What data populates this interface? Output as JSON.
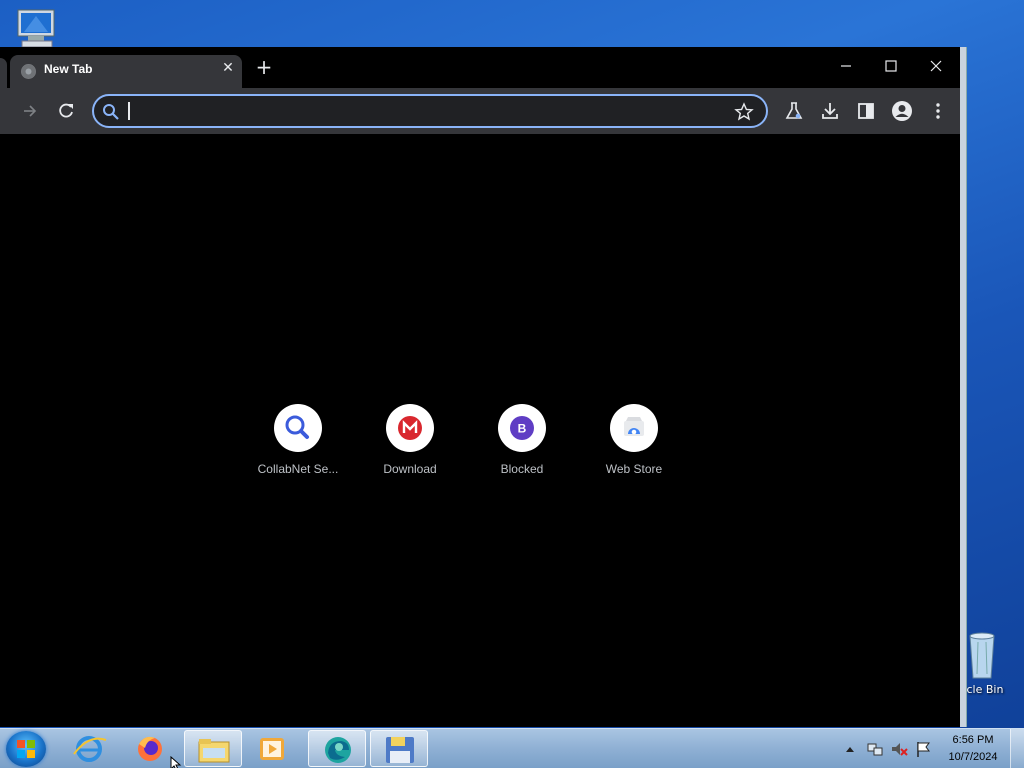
{
  "browser": {
    "tab": {
      "title": "New Tab"
    },
    "omnibox": {
      "value": "",
      "placeholder": ""
    },
    "shortcuts": [
      {
        "label": "CollabNet Se...",
        "icon": "collabnet-search-icon",
        "color": "#3b5bdb"
      },
      {
        "label": "Download",
        "icon": "mega-icon",
        "color": "#d9272e"
      },
      {
        "label": "Blocked",
        "icon": "b-letter-icon",
        "color": "#5f3dc4",
        "letter": "B"
      },
      {
        "label": "Web Store",
        "icon": "web-store-icon",
        "color": "#4285f4"
      }
    ]
  },
  "desktop": {
    "recycle_bin_label": "ycle Bin"
  },
  "taskbar": {
    "clock_time": "6:56 PM",
    "clock_date": "10/7/2024"
  },
  "colors": {
    "accent": "#8ab4f8",
    "toolbar": "#35363a",
    "page_bg": "#000000"
  }
}
